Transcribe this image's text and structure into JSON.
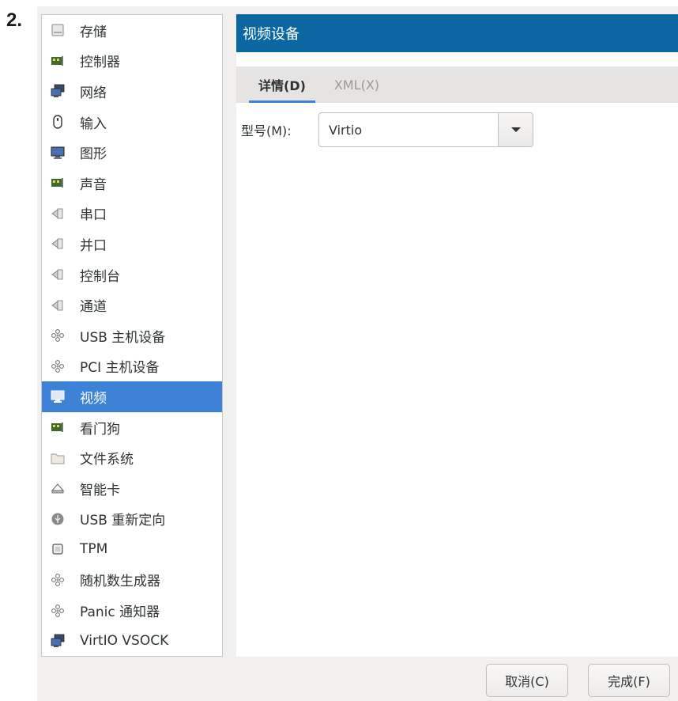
{
  "step": {
    "number": "2."
  },
  "sidebar": {
    "items": [
      {
        "label": "存储",
        "icon": "storage-icon"
      },
      {
        "label": "控制器",
        "icon": "controller-card-icon"
      },
      {
        "label": "网络",
        "icon": "network-icon"
      },
      {
        "label": "输入",
        "icon": "mouse-icon"
      },
      {
        "label": "图形",
        "icon": "monitor-icon"
      },
      {
        "label": "声音",
        "icon": "sound-card-icon"
      },
      {
        "label": "串口",
        "icon": "serial-port-icon"
      },
      {
        "label": "并口",
        "icon": "parallel-port-icon"
      },
      {
        "label": "控制台",
        "icon": "console-port-icon"
      },
      {
        "label": "通道",
        "icon": "channel-port-icon"
      },
      {
        "label": "USB 主机设备",
        "icon": "usb-host-device-icon"
      },
      {
        "label": "PCI 主机设备",
        "icon": "pci-host-device-icon"
      },
      {
        "label": "视频",
        "icon": "video-monitor-icon",
        "selected": true
      },
      {
        "label": "看门狗",
        "icon": "watchdog-card-icon"
      },
      {
        "label": "文件系统",
        "icon": "folder-icon"
      },
      {
        "label": "智能卡",
        "icon": "smartcard-icon"
      },
      {
        "label": "USB 重新定向",
        "icon": "usb-redirect-icon"
      },
      {
        "label": "TPM",
        "icon": "tpm-chip-icon"
      },
      {
        "label": "随机数生成器",
        "icon": "rng-device-icon"
      },
      {
        "label": "Panic 通知器",
        "icon": "panic-notifier-icon"
      },
      {
        "label": "VirtIO VSOCK",
        "icon": "vsock-network-icon"
      }
    ]
  },
  "main": {
    "title": "视频设备",
    "tabs": [
      {
        "label": "详情(D)",
        "active": true
      },
      {
        "label": "XML(X)",
        "active": false
      }
    ],
    "model_field": {
      "label": "型号(M):",
      "value": "Virtio"
    }
  },
  "buttons": {
    "cancel": "取消(C)",
    "finish": "完成(F)"
  },
  "colors": {
    "title_bar": "#0b67a1",
    "selection": "#3d82d6",
    "tab_underline": "#3d82d6"
  }
}
